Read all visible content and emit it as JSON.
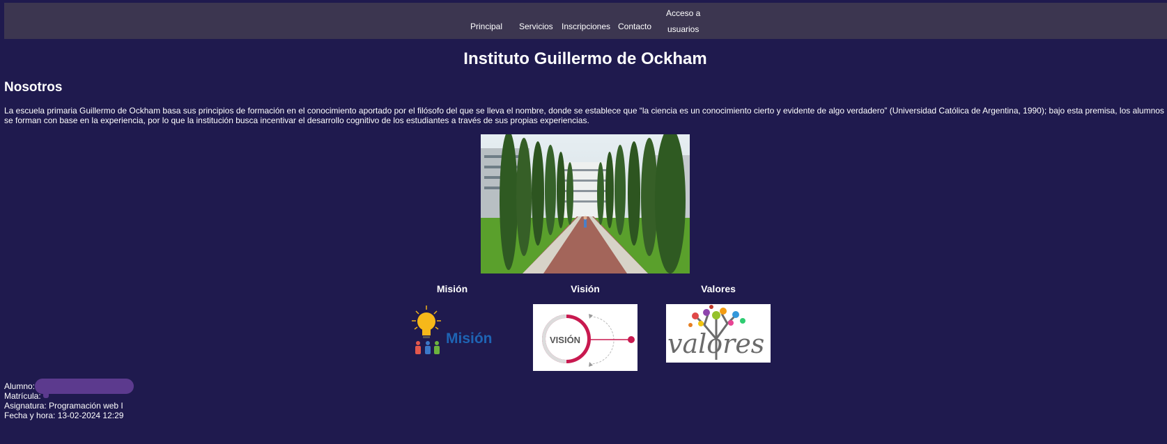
{
  "nav": {
    "principal": "Principal",
    "servicios": "Servicios",
    "inscripciones": "Inscripciones",
    "contacto": "Contacto",
    "acceso_line1": "Acceso a",
    "acceso_line2": "usuarios"
  },
  "page": {
    "title": "Instituto Guillermo de Ockham",
    "section_title": "Nosotros",
    "intro": "La escuela primaria Guillermo de Ockham basa sus principios de formación en el conocimiento aportado por el filósofo del que se lleva el nombre, donde se establece que “la ciencia es un conocimiento cierto y evidente de algo verdadero” (Universidad Católica de Argentina, 1990); bajo esta premisa, los alumnos se forman con base en la experiencia, por lo que la institución busca incentivar el desarrollo cognitivo de los estudiantes a través de sus propias experiencias."
  },
  "columns": {
    "mision": {
      "title": "Misión",
      "image_text": "Misión",
      "icon": "lightbulb-people-icon"
    },
    "vision": {
      "title": "Visión",
      "image_text": "VISIÓN",
      "icon": "vision-target-icon"
    },
    "valores": {
      "title": "Valores",
      "image_text": "valores",
      "icon": "values-tree-icon"
    }
  },
  "footer": {
    "alumno_label": "Alumno:",
    "matricula_label": "Matrícula:",
    "asignatura": "Asignatura: Programación web I",
    "fecha": "Fecha y hora: 13-02-2024 12:29"
  },
  "colors": {
    "background": "#1f1a4e",
    "navbar": "#3c3650",
    "mision_blue": "#1e64b4",
    "vision_red": "#c8194f",
    "redaction": "#5c3a8e"
  }
}
